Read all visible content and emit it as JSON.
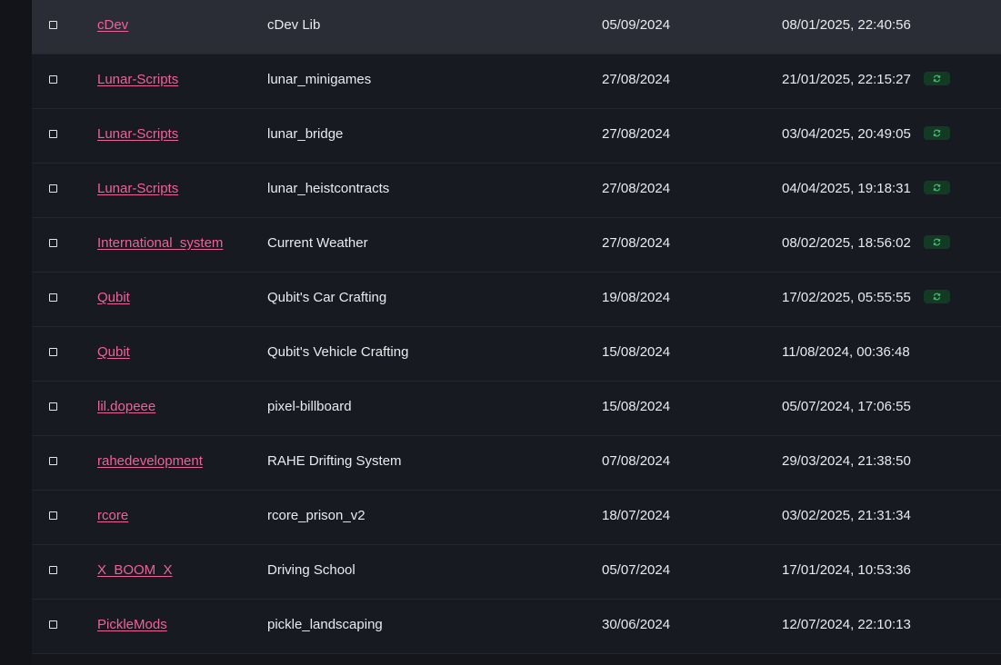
{
  "rows": [
    {
      "author": "cDev",
      "name": "cDev Lib",
      "date": "05/09/2024",
      "updated": "08/01/2025, 22:40:56",
      "badge": false,
      "highlight": true
    },
    {
      "author": "Lunar-Scripts",
      "name": "lunar_minigames",
      "date": "27/08/2024",
      "updated": "21/01/2025, 22:15:27",
      "badge": true
    },
    {
      "author": "Lunar-Scripts",
      "name": "lunar_bridge",
      "date": "27/08/2024",
      "updated": "03/04/2025, 20:49:05",
      "badge": true
    },
    {
      "author": "Lunar-Scripts",
      "name": "lunar_heistcontracts",
      "date": "27/08/2024",
      "updated": "04/04/2025, 19:18:31",
      "badge": true
    },
    {
      "author": "International_system",
      "name": "Current Weather",
      "date": "27/08/2024",
      "updated": "08/02/2025, 18:56:02",
      "badge": true
    },
    {
      "author": "Qubit",
      "name": "Qubit's Car Crafting",
      "date": "19/08/2024",
      "updated": "17/02/2025, 05:55:55",
      "badge": true
    },
    {
      "author": "Qubit",
      "name": "Qubit's Vehicle Crafting",
      "date": "15/08/2024",
      "updated": "11/08/2024, 00:36:48",
      "badge": false
    },
    {
      "author": "lil.dopeee",
      "name": "pixel-billboard",
      "date": "15/08/2024",
      "updated": "05/07/2024, 17:06:55",
      "badge": false
    },
    {
      "author": "rahedevelopment",
      "name": "RAHE Drifting System",
      "date": "07/08/2024",
      "updated": "29/03/2024, 21:38:50",
      "badge": false
    },
    {
      "author": "rcore",
      "name": "rcore_prison_v2",
      "date": "18/07/2024",
      "updated": "03/02/2025, 21:31:34",
      "badge": false
    },
    {
      "author": "X_BOOM_X",
      "name": "Driving School",
      "date": "05/07/2024",
      "updated": "17/01/2024, 10:53:36",
      "badge": false
    },
    {
      "author": "PickleMods",
      "name": "pickle_landscaping",
      "date": "30/06/2024",
      "updated": "12/07/2024, 22:10:13",
      "badge": false
    }
  ],
  "badge_icon": "refresh-icon",
  "colors": {
    "author_link": "#f0609d",
    "badge_bg": "#133b24",
    "badge_icon": "#35c56a",
    "row_highlight": "#2a2d36"
  }
}
